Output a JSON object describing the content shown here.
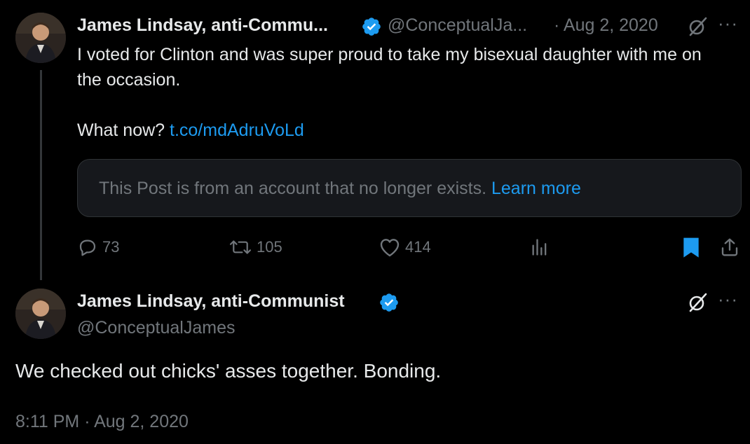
{
  "reply_tweet": {
    "author_name": "James Lindsay, anti-Commu...",
    "handle": "@ConceptualJa...",
    "date": "· Aug 2, 2020",
    "text_line1": "I voted for Clinton and was super proud to take my bisexual daughter with me on the occasion.",
    "text_line2_prefix": "What now? ",
    "link": "t.co/mdAdruVoLd",
    "notice_text": "This Post is from an account that no longer exists. ",
    "notice_link": "Learn more",
    "actions": {
      "replies": "73",
      "reposts": "105",
      "likes": "414"
    }
  },
  "main_tweet": {
    "author_name": "James Lindsay, anti-Communist",
    "handle": "@ConceptualJames",
    "text": "We checked out chicks' asses together. Bonding.",
    "timestamp": "8:11 PM · Aug 2, 2020"
  },
  "icons": {
    "verified": "verified-badge-icon",
    "grok": "grok-icon",
    "more": "more-options-icon",
    "reply": "reply-icon",
    "repost": "repost-icon",
    "like": "like-icon",
    "views": "views-icon",
    "bookmark": "bookmark-icon",
    "share": "share-icon"
  },
  "colors": {
    "background": "#000000",
    "text": "#e7e9ea",
    "muted": "#71767b",
    "accent": "#1d9bf0"
  }
}
